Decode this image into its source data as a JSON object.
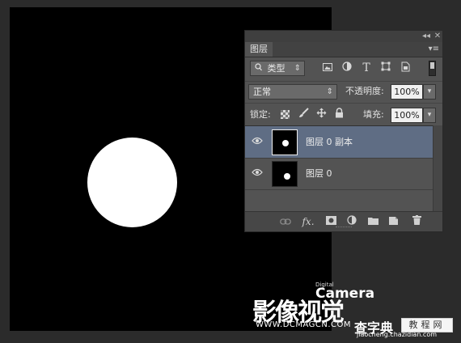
{
  "panel": {
    "controls": {
      "collapse": "◂◂",
      "close": "✕"
    },
    "tab": "图层",
    "menu": "▾≡",
    "filter": {
      "kind_label": "类型",
      "kind_arrow": "⇕",
      "icons": [
        "image-filter-icon",
        "adjustment-filter-icon",
        "type-filter-icon",
        "shape-filter-icon",
        "smart-object-filter-icon"
      ]
    },
    "blend": {
      "mode": "正常",
      "mode_arrow": "⇕",
      "opacity_label": "不透明度:",
      "opacity_value": "100%",
      "dropdown_arrow": "▾"
    },
    "lock": {
      "label": "锁定:",
      "icons": [
        "lock-transparent-pixels-icon",
        "lock-image-pixels-icon",
        "lock-position-icon",
        "lock-all-icon"
      ],
      "fill_label": "填充:",
      "fill_value": "100%",
      "dropdown_arrow": "▾"
    },
    "layers": [
      {
        "name": "图层 0 副本",
        "selected": true,
        "visible": true
      },
      {
        "name": "图层 0",
        "selected": false,
        "visible": true
      }
    ],
    "bottom_icons": [
      "link-layers-icon",
      "layer-style-fx-icon",
      "add-mask-icon",
      "adjustment-layer-icon",
      "new-group-folder-icon",
      "new-layer-icon",
      "delete-trash-icon"
    ]
  },
  "watermark": {
    "digital": "Digital",
    "camera": "Camera",
    "cn": "影像视觉",
    "url": "WWW.DCMAGCN.COM"
  },
  "stamp": {
    "cn": "查字典",
    "box": "教程网",
    "url": "jiaocheng.chazidian.com"
  }
}
